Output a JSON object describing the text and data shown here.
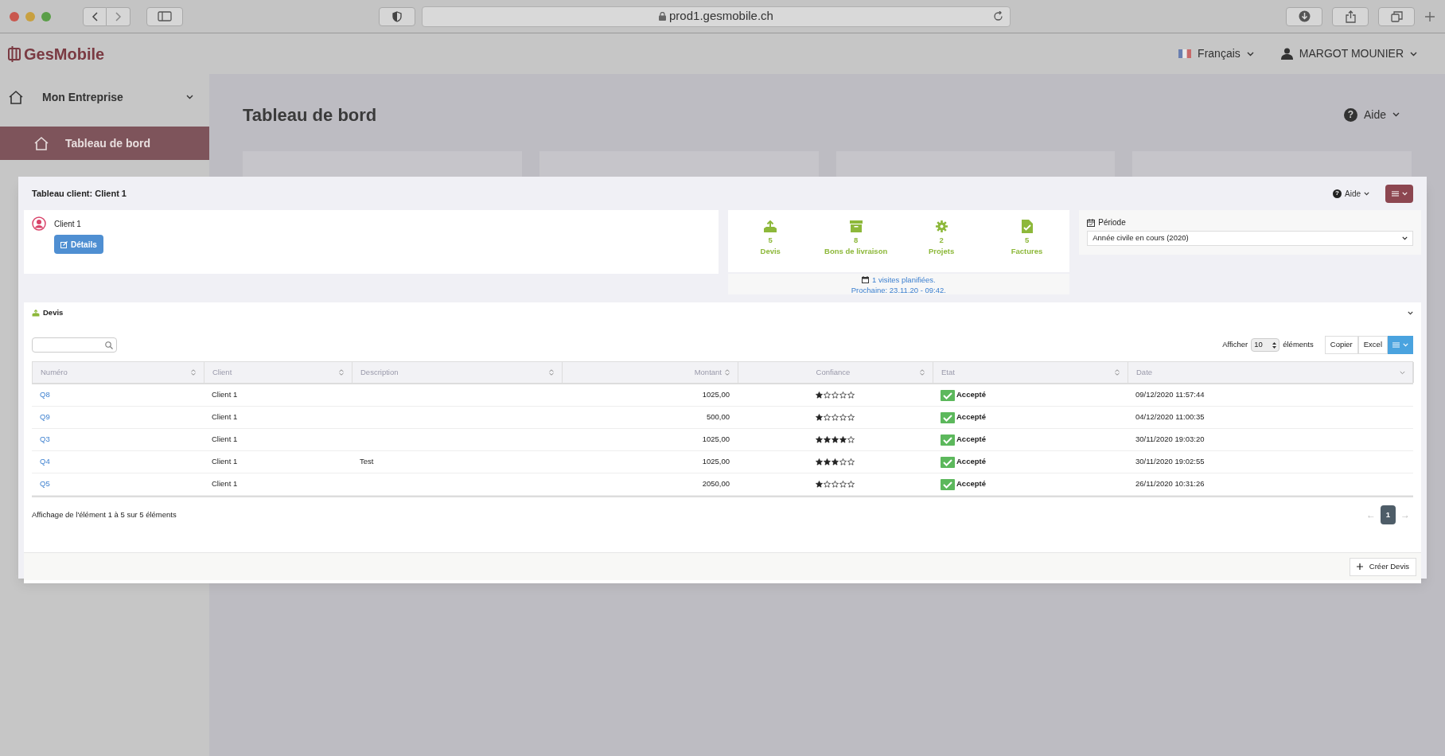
{
  "browser": {
    "url": "prod1.gesmobile.ch"
  },
  "header": {
    "logo": "GesMobile",
    "language": "Français",
    "user": "MARGOT MOUNIER"
  },
  "sidebar": {
    "items": [
      {
        "label": "Mon Entreprise",
        "kind": "group",
        "selected": false
      },
      {
        "label": "Tableau de bord",
        "kind": "page",
        "selected": true
      }
    ]
  },
  "page": {
    "title": "Tableau de bord",
    "help_icon": "?",
    "help": "Aide"
  },
  "modal": {
    "title": "Tableau client: Client 1",
    "help_icon": "?",
    "help": "Aide",
    "client": {
      "name": "Client 1",
      "details_button": "Détails"
    },
    "stats": [
      {
        "kind": "devis",
        "count": "5",
        "label": "Devis"
      },
      {
        "kind": "archive",
        "count": "8",
        "label": "Bons de livraison"
      },
      {
        "kind": "gear",
        "count": "2",
        "label": "Projets"
      },
      {
        "kind": "invoice",
        "count": "5",
        "label": "Factures"
      }
    ],
    "visits": {
      "link": "1 visites planifiées.",
      "next": "Prochaine: 23.11.20 - 09:42."
    },
    "period": {
      "label": "Période",
      "value": "Année civile en cours (2020)"
    },
    "section": {
      "title": "Devis",
      "show_label": "Afficher",
      "page_size": "10",
      "items_label": "éléments",
      "buttons": [
        "Copier",
        "Excel"
      ],
      "columns": [
        {
          "label": "Numéro",
          "sorted": false
        },
        {
          "label": "Client",
          "sorted": false
        },
        {
          "label": "Description",
          "sorted": false
        },
        {
          "label": "Montant",
          "sorted": false
        },
        {
          "label": "Confiance",
          "sorted": false
        },
        {
          "label": "Etat",
          "sorted": false
        },
        {
          "label": "Date",
          "sorted": true
        }
      ],
      "rows": [
        {
          "number": "Q8",
          "client": "Client 1",
          "amount": "1025,00",
          "stars": 1,
          "status": "Accepté",
          "date": "09/12/2020 11:57:44"
        },
        {
          "number": "Q9",
          "client": "Client 1",
          "amount": "500,00",
          "stars": 1,
          "status": "Accepté",
          "date": "04/12/2020 11:00:35"
        },
        {
          "number": "Q3",
          "client": "Client 1",
          "amount": "1025,00",
          "stars": 4,
          "status": "Accepté",
          "date": "30/11/2020 19:03:20"
        },
        {
          "number": "Q4",
          "client": "Client 1",
          "description": "Test",
          "amount": "1025,00",
          "stars": 3,
          "status": "Accepté",
          "date": "30/11/2020 19:02:55"
        },
        {
          "number": "Q5",
          "client": "Client 1",
          "amount": "2050,00",
          "stars": 1,
          "status": "Accepté",
          "date": "26/11/2020 10:31:26"
        }
      ],
      "info": "Affichage de l'élément 1 à 5 sur 5 éléments",
      "pagination": [
        {
          "label": "←",
          "selected": false
        },
        {
          "label": "1",
          "selected": true
        },
        {
          "label": "→",
          "selected": false
        }
      ],
      "create_button": "Créer Devis"
    }
  }
}
